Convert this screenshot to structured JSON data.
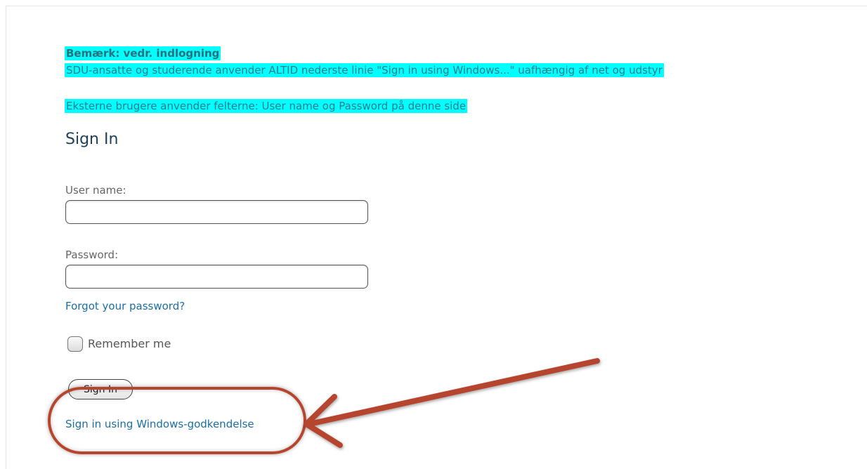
{
  "notice": {
    "title": "Bemærk: vedr. indlogning",
    "line1": "SDU-ansatte og studerende anvender ALTID nederste linie \"Sign in using Windows...\" uafhængig af net og udstyr",
    "line2": "Eksterne brugere anvender felterne: User name og Password på denne side",
    "highlight_color": "#00ffff"
  },
  "signin": {
    "title": "Sign In",
    "username_label": "User name:",
    "username_value": "",
    "password_label": "Password:",
    "password_value": "",
    "forgot_link": "Forgot your password?",
    "remember_label": "Remember me",
    "remember_checked": false,
    "signin_button": "Sign In",
    "windows_link": "Sign in using Windows-godkendelse"
  },
  "annotation": {
    "color": "#b5452d",
    "arrow_icon": "arrow-icon",
    "oval": "highlight-oval"
  }
}
